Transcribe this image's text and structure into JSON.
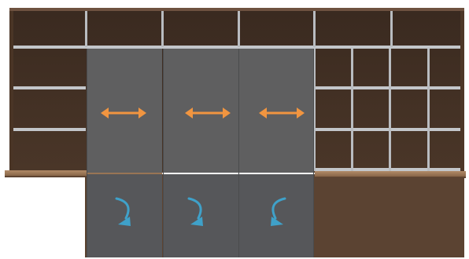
{
  "scene": {
    "description_tag": "furniture-wall-unit",
    "colors": {
      "background": "#ffffff",
      "wood_dark": "#5a4130",
      "wood_back": "#3f2e23",
      "wood_light": "#a07a58",
      "shelf_gray": "#c8cbcf",
      "panel_gray": "#5f5f60",
      "panel_gray_shade": "#56575a",
      "orange_arrow": "#f19540",
      "teal_arrow": "#3fa1c9",
      "desk_top": "#9b7553"
    },
    "sliding_doors": {
      "count": 3,
      "arrow_icon": "double-headed-horizontal-arrow"
    },
    "hinged_doors": {
      "count": 3,
      "arrow_icon": "curved-rotation-arrow"
    }
  }
}
